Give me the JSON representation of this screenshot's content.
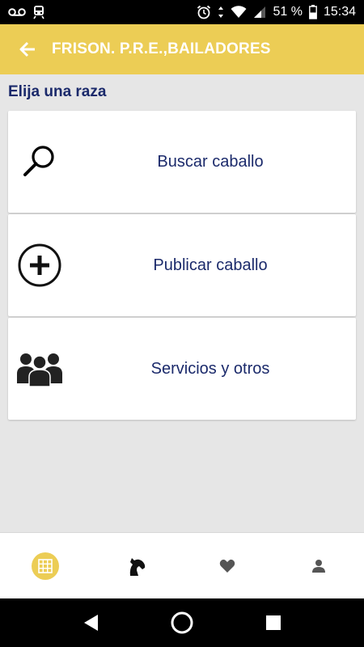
{
  "status_bar": {
    "battery_percent": "51 %",
    "time": "15:34",
    "icons": [
      "voicemail-icon",
      "train-icon",
      "alarm-icon",
      "data-arrows-icon",
      "wifi-icon",
      "signal-icon",
      "battery-icon"
    ]
  },
  "app_bar": {
    "title": "FRISON. P.R.E.,BAILADORES",
    "back_icon": "arrow-left-icon"
  },
  "section_title": "Elija una raza",
  "cards": [
    {
      "label": "Buscar caballo",
      "icon": "search-icon"
    },
    {
      "label": "Publicar caballo",
      "icon": "add-circle-icon"
    },
    {
      "label": "Servicios y otros",
      "icon": "group-icon"
    }
  ],
  "bottom_nav": [
    {
      "name": "grid",
      "icon": "grid-icon",
      "active": true
    },
    {
      "name": "horse",
      "icon": "horse-head-icon",
      "active": false
    },
    {
      "name": "favorites",
      "icon": "heart-icon",
      "active": false
    },
    {
      "name": "profile",
      "icon": "person-icon",
      "active": false
    }
  ],
  "colors": {
    "accent": "#eccd55",
    "text_primary": "#1b2a6b",
    "background": "#e6e6e6"
  }
}
